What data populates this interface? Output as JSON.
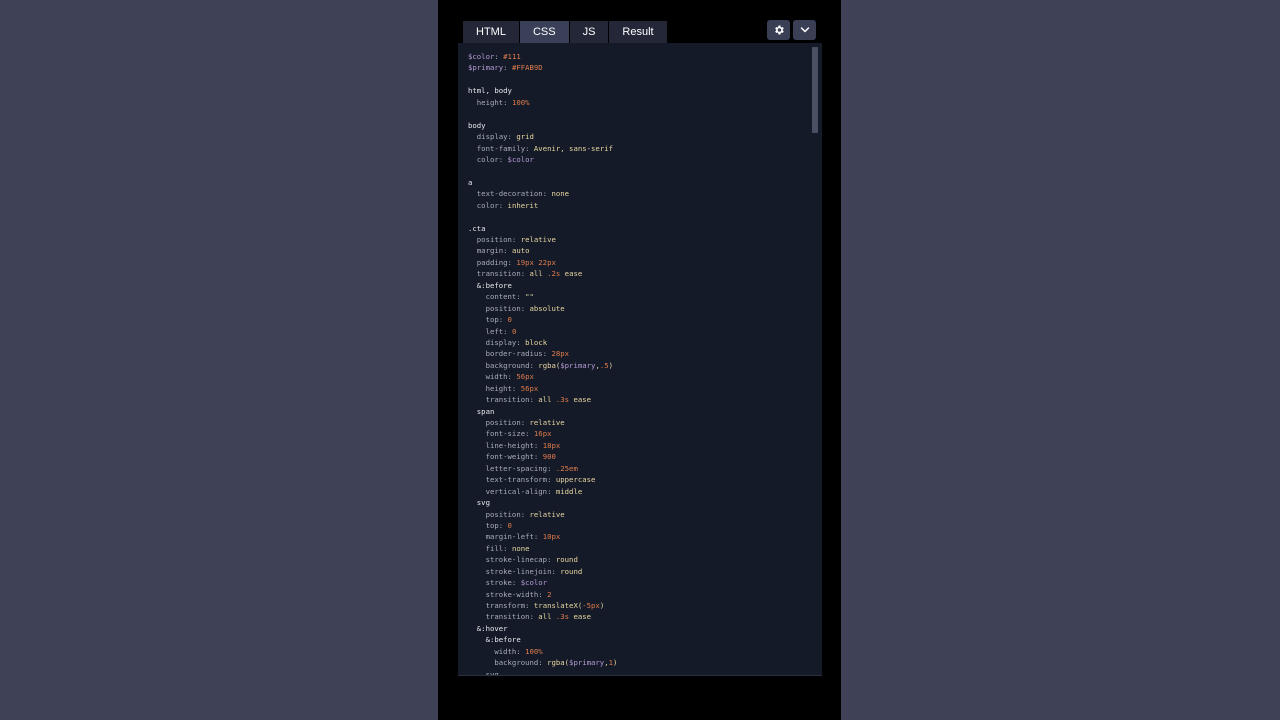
{
  "tabs": [
    {
      "label": "HTML",
      "active": false
    },
    {
      "label": "CSS",
      "active": true
    },
    {
      "label": "JS",
      "active": false
    },
    {
      "label": "Result",
      "active": false
    }
  ],
  "toolbar": {
    "settings_icon": "gear-icon",
    "menu_icon": "chevron-down-icon"
  },
  "colors": {
    "background": "#3f4157",
    "editor_bg": "#141a28",
    "tab_active": "#3a4058",
    "tab_inactive": "#232737"
  },
  "code_lines": [
    [
      [
        "var",
        "$color"
      ],
      [
        "prop",
        ": "
      ],
      [
        "num",
        "#111"
      ]
    ],
    [
      [
        "var",
        "$primary"
      ],
      [
        "prop",
        ": "
      ],
      [
        "num",
        "#FFAB9D"
      ]
    ],
    [],
    [
      [
        "sel",
        "html, body"
      ]
    ],
    [
      [
        "prop",
        "  height: "
      ],
      [
        "num",
        "100%"
      ]
    ],
    [],
    [
      [
        "sel",
        "body"
      ]
    ],
    [
      [
        "prop",
        "  display: "
      ],
      [
        "val",
        "grid"
      ]
    ],
    [
      [
        "prop",
        "  font-family: "
      ],
      [
        "val",
        "Avenir, sans-serif"
      ]
    ],
    [
      [
        "prop",
        "  color: "
      ],
      [
        "var",
        "$color"
      ]
    ],
    [],
    [
      [
        "sel",
        "a"
      ]
    ],
    [
      [
        "prop",
        "  text-decoration: "
      ],
      [
        "val",
        "none"
      ]
    ],
    [
      [
        "prop",
        "  color: "
      ],
      [
        "val",
        "inherit"
      ]
    ],
    [],
    [
      [
        "sel",
        ".cta"
      ]
    ],
    [
      [
        "prop",
        "  position: "
      ],
      [
        "val",
        "relative"
      ]
    ],
    [
      [
        "prop",
        "  margin: "
      ],
      [
        "val",
        "auto"
      ]
    ],
    [
      [
        "prop",
        "  padding: "
      ],
      [
        "num",
        "19px 22px"
      ]
    ],
    [
      [
        "prop",
        "  transition: "
      ],
      [
        "val",
        "all "
      ],
      [
        "num",
        ".2s"
      ],
      [
        "val",
        " ease"
      ]
    ],
    [
      [
        "sel",
        "  &:before"
      ]
    ],
    [
      [
        "prop",
        "    content: "
      ],
      [
        "str",
        "\"\""
      ]
    ],
    [
      [
        "prop",
        "    position: "
      ],
      [
        "val",
        "absolute"
      ]
    ],
    [
      [
        "prop",
        "    top: "
      ],
      [
        "num",
        "0"
      ]
    ],
    [
      [
        "prop",
        "    left: "
      ],
      [
        "num",
        "0"
      ]
    ],
    [
      [
        "prop",
        "    display: "
      ],
      [
        "val",
        "block"
      ]
    ],
    [
      [
        "prop",
        "    border-radius: "
      ],
      [
        "num",
        "28px"
      ]
    ],
    [
      [
        "prop",
        "    background: "
      ],
      [
        "val",
        "rgba("
      ],
      [
        "var",
        "$primary"
      ],
      [
        "val",
        ","
      ],
      [
        "num",
        ".5"
      ],
      [
        "val",
        ")"
      ]
    ],
    [
      [
        "prop",
        "    width: "
      ],
      [
        "num",
        "56px"
      ]
    ],
    [
      [
        "prop",
        "    height: "
      ],
      [
        "num",
        "56px"
      ]
    ],
    [
      [
        "prop",
        "    transition: "
      ],
      [
        "val",
        "all "
      ],
      [
        "num",
        ".3s"
      ],
      [
        "val",
        " ease"
      ]
    ],
    [
      [
        "sel",
        "  span"
      ]
    ],
    [
      [
        "prop",
        "    position: "
      ],
      [
        "val",
        "relative"
      ]
    ],
    [
      [
        "prop",
        "    font-size: "
      ],
      [
        "num",
        "16px"
      ]
    ],
    [
      [
        "prop",
        "    line-height: "
      ],
      [
        "num",
        "18px"
      ]
    ],
    [
      [
        "prop",
        "    font-weight: "
      ],
      [
        "num",
        "900"
      ]
    ],
    [
      [
        "prop",
        "    letter-spacing: "
      ],
      [
        "num",
        ".25em"
      ]
    ],
    [
      [
        "prop",
        "    text-transform: "
      ],
      [
        "val",
        "uppercase"
      ]
    ],
    [
      [
        "prop",
        "    vertical-align: "
      ],
      [
        "val",
        "middle"
      ]
    ],
    [
      [
        "sel",
        "  svg"
      ]
    ],
    [
      [
        "prop",
        "    position: "
      ],
      [
        "val",
        "relative"
      ]
    ],
    [
      [
        "prop",
        "    top: "
      ],
      [
        "num",
        "0"
      ]
    ],
    [
      [
        "prop",
        "    margin-left: "
      ],
      [
        "num",
        "10px"
      ]
    ],
    [
      [
        "prop",
        "    fill: "
      ],
      [
        "val",
        "none"
      ]
    ],
    [
      [
        "prop",
        "    stroke-linecap: "
      ],
      [
        "val",
        "round"
      ]
    ],
    [
      [
        "prop",
        "    stroke-linejoin: "
      ],
      [
        "val",
        "round"
      ]
    ],
    [
      [
        "prop",
        "    stroke: "
      ],
      [
        "var",
        "$color"
      ]
    ],
    [
      [
        "prop",
        "    stroke-width: "
      ],
      [
        "num",
        "2"
      ]
    ],
    [
      [
        "prop",
        "    transform: "
      ],
      [
        "val",
        "translateX("
      ],
      [
        "num",
        "-5px"
      ],
      [
        "val",
        ")"
      ]
    ],
    [
      [
        "prop",
        "    transition: "
      ],
      [
        "val",
        "all "
      ],
      [
        "num",
        ".3s"
      ],
      [
        "val",
        " ease"
      ]
    ],
    [
      [
        "sel",
        "  &:hover"
      ]
    ],
    [
      [
        "sel",
        "    &:before"
      ]
    ],
    [
      [
        "prop",
        "      width: "
      ],
      [
        "num",
        "100%"
      ]
    ],
    [
      [
        "prop",
        "      background: "
      ],
      [
        "val",
        "rgba("
      ],
      [
        "var",
        "$primary"
      ],
      [
        "val",
        ","
      ],
      [
        "num",
        "1"
      ],
      [
        "val",
        ")"
      ]
    ],
    [
      [
        "prop",
        "    svg"
      ]
    ]
  ]
}
